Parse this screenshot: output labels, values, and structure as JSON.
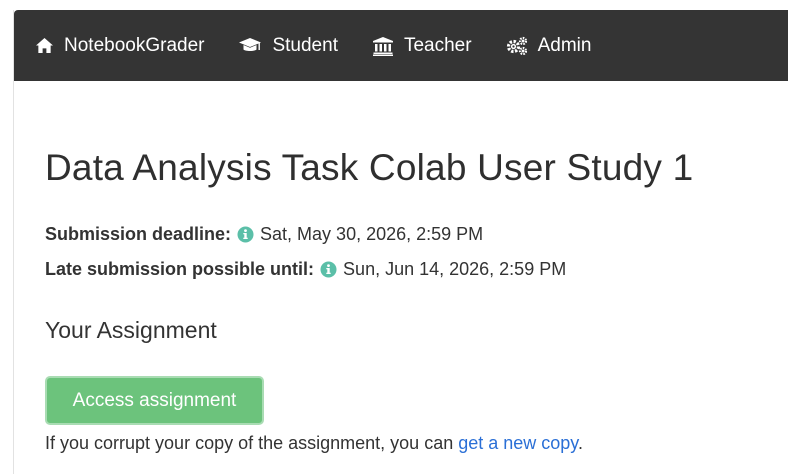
{
  "navbar": {
    "items": [
      {
        "label": "NotebookGrader",
        "icon": "home-icon"
      },
      {
        "label": "Student",
        "icon": "graduation-cap-icon"
      },
      {
        "label": "Teacher",
        "icon": "institution-icon"
      },
      {
        "label": "Admin",
        "icon": "cogs-icon"
      }
    ]
  },
  "assignment": {
    "title": "Data Analysis Task Colab User Study 1",
    "deadline_label": "Submission deadline:",
    "deadline_value": "Sat, May 30, 2026, 2:59 PM",
    "late_label": "Late submission possible until:",
    "late_value": "Sun, Jun 14, 2026, 2:59 PM",
    "section_title": "Your Assignment",
    "access_button": "Access assignment",
    "note_prefix": "If you corrupt your copy of the assignment, you can ",
    "note_link": "get a new copy",
    "note_suffix": "."
  },
  "colors": {
    "navbar_bg": "#343434",
    "button_green": "#6cc37c",
    "info_icon": "#5bbfa8",
    "link_blue": "#2a6fd6"
  }
}
